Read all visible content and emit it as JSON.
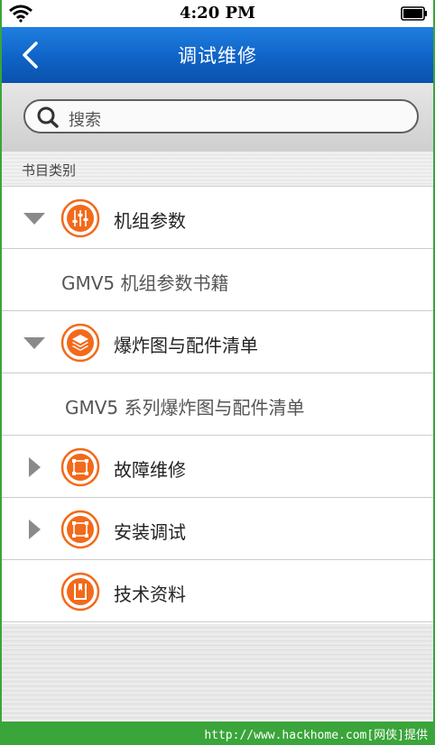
{
  "status_bar": {
    "time": "4:20 PM",
    "wifi_icon": "wifi-icon",
    "battery_icon": "battery-icon"
  },
  "nav": {
    "title": "调试维修",
    "back_icon": "chevron-left-icon"
  },
  "search": {
    "placeholder": "搜索",
    "icon": "search-icon"
  },
  "section": {
    "label": "书目类别"
  },
  "list": {
    "items": [
      {
        "type": "category",
        "label": "机组参数",
        "expanded": true,
        "icon": "sliders-icon"
      },
      {
        "type": "subitem",
        "label": "GMV5 机组参数书籍"
      },
      {
        "type": "category",
        "label": "爆炸图与配件清单",
        "expanded": true,
        "icon": "layers-icon"
      },
      {
        "type": "subitem",
        "label": "GMV5 系列爆炸图与配件清单"
      },
      {
        "type": "category",
        "label": "故障维修",
        "expanded": false,
        "icon": "frame-icon"
      },
      {
        "type": "category",
        "label": "安装调试",
        "expanded": false,
        "icon": "frame-icon"
      },
      {
        "type": "category",
        "label": "技术资料",
        "expanded": null,
        "icon": "book-icon"
      }
    ]
  },
  "watermark": {
    "text": "http://www.hackhome.com[网侠]提供"
  },
  "colors": {
    "nav_blue": "#0f63c6",
    "accent_orange": "#f26a1b",
    "watermark_green": "#3aa53a"
  }
}
